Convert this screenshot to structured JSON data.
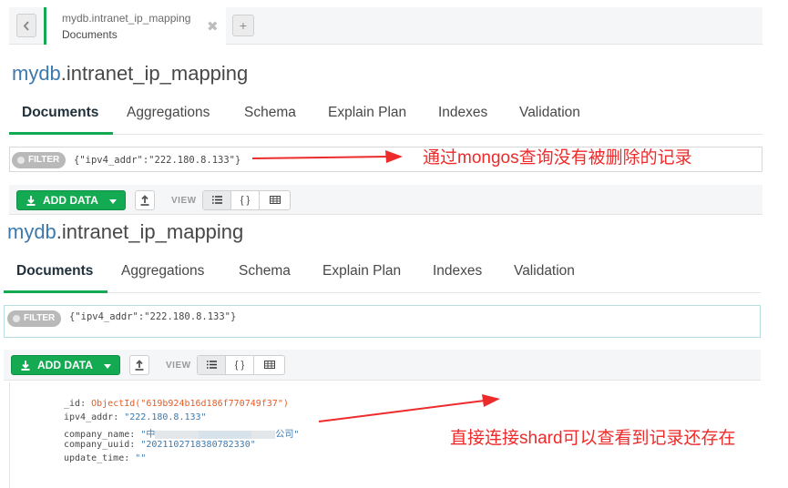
{
  "tab": {
    "namespace": "mydb.intranet_ip_mapping",
    "subtitle": "Documents",
    "close_glyph": "✖",
    "add_glyph": "+"
  },
  "panels": [
    {
      "title_db": "mydb",
      "title_coll": ".intranet_ip_mapping",
      "tabs": [
        "Documents",
        "Aggregations",
        "Schema",
        "Explain Plan",
        "Indexes",
        "Validation"
      ],
      "active_tab": "Documents",
      "filter_label": "FILTER",
      "filter_query": "{\"ipv4_addr\":\"222.180.8.133\"}",
      "add_data_label": "ADD DATA",
      "view_label": "VIEW",
      "view_icons": [
        "list-view-icon",
        "json-view-icon",
        "table-view-icon"
      ]
    },
    {
      "title_db": "mydb",
      "title_coll": ".intranet_ip_mapping",
      "tabs": [
        "Documents",
        "Aggregations",
        "Schema",
        "Explain Plan",
        "Indexes",
        "Validation"
      ],
      "active_tab": "Documents",
      "filter_label": "FILTER",
      "filter_query": "{\"ipv4_addr\":\"222.180.8.133\"}",
      "add_data_label": "ADD DATA",
      "view_label": "VIEW",
      "view_icons": [
        "list-view-icon",
        "json-view-icon",
        "table-view-icon"
      ]
    }
  ],
  "document": {
    "id_key": "_id",
    "id_func": "ObjectId(\"619b924b16d186f770749f37\")",
    "ipv4_key": "ipv4_addr",
    "ipv4_val": "\"222.180.8.133\"",
    "company_name_key": "company_name",
    "company_name_prefix": "\"中",
    "company_name_suffix": "公司\"",
    "company_uuid_key": "company_uuid",
    "company_uuid_val": "\"2021102718380782330\"",
    "update_time_key": "update_time",
    "update_time_val": "\"\""
  },
  "annotations": {
    "top": "通过mongos查询没有被删除的记录",
    "bottom": "直接连接shard可以查看到记录还存在"
  },
  "colors": {
    "accent_green": "#13aa52",
    "db_blue": "#3d79ad",
    "objectid_orange": "#e85b23",
    "annotation_red": "#ee2b2b"
  }
}
